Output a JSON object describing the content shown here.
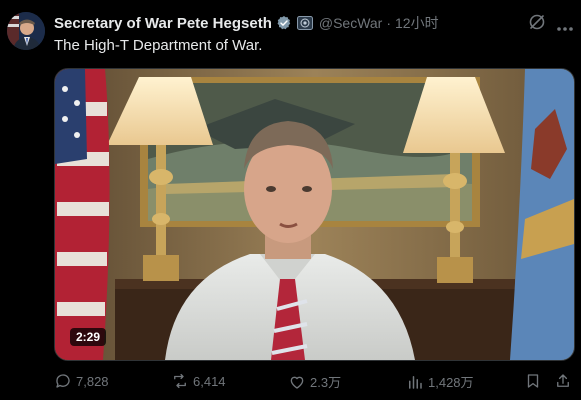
{
  "tweet": {
    "author_name": "Secretary of War Pete Hegseth",
    "handle": "@SecWar",
    "separator": "·",
    "time": "12小时",
    "text": "The High-T Department of War.",
    "video_duration": "2:29"
  },
  "actions": {
    "replies": "7,828",
    "reposts": "6,414",
    "likes": "2.3万",
    "views": "1,428万"
  },
  "icons": {
    "verified": "verified-badge-icon",
    "affiliate": "government-badge-icon",
    "grok": "grok-icon",
    "more": "more-icon",
    "reply": "reply-icon",
    "repost": "repost-icon",
    "like": "like-icon",
    "views": "views-icon",
    "bookmark": "bookmark-icon",
    "share": "share-icon"
  },
  "colors": {
    "accent": "#1d9bf0",
    "muted": "#71767b",
    "text": "#e7e9ea"
  }
}
